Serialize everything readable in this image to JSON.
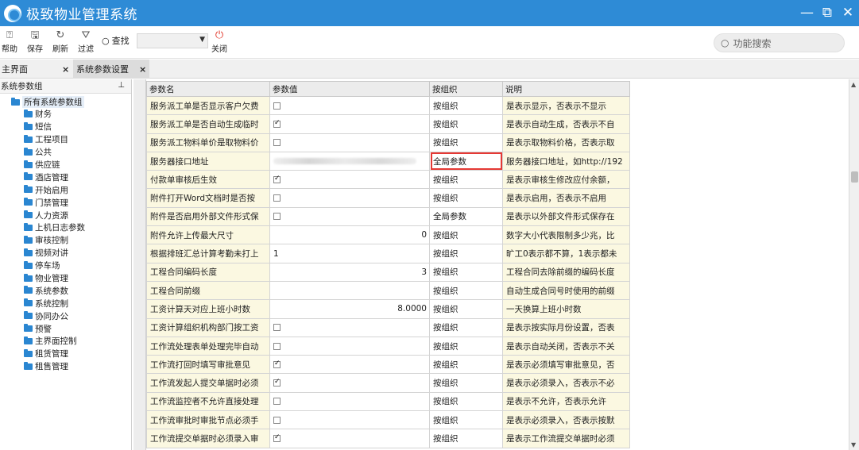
{
  "window": {
    "title": "极致物业管理系统",
    "controls": [
      "—",
      "⧉",
      "✕"
    ]
  },
  "toolbar": {
    "help": "帮助",
    "save": "保存",
    "refresh": "刷新",
    "filter": "过滤",
    "find": "查找",
    "find_select_value": "",
    "close": "关闭",
    "function_search_placeholder": "功能搜索"
  },
  "tabs": [
    {
      "label": "主界面"
    },
    {
      "label": "系统参数设置"
    }
  ],
  "left_panel": {
    "header": "系统参数组",
    "root": "所有系统参数组",
    "groups": [
      "财务",
      "短信",
      "工程项目",
      "公共",
      "供应链",
      "酒店管理",
      "开始启用",
      "门禁管理",
      "人力资源",
      "上机日志参数",
      "审核控制",
      "视频对讲",
      "停车场",
      "物业管理",
      "系统参数",
      "系统控制",
      "协同办公",
      "预警",
      "主界面控制",
      "租赁管理",
      "租售管理"
    ]
  },
  "grid": {
    "columns": [
      "参数名",
      "参数值",
      "按组织",
      "说明"
    ],
    "rows": [
      {
        "name": "服务派工单是否显示客户欠费",
        "type": "check",
        "checked": false,
        "value": "",
        "org": "按组织",
        "desc": "是表示显示，否表示不显示"
      },
      {
        "name": "服务派工单是否自动生成临时",
        "type": "check",
        "checked": true,
        "value": "",
        "org": "按组织",
        "desc": "是表示自动生成，否表示不自"
      },
      {
        "name": "服务派工物料单价是取物料价",
        "type": "check",
        "checked": false,
        "value": "",
        "org": "按组织",
        "desc": "是表示取物料价格，否表示取"
      },
      {
        "name": "服务器接口地址",
        "type": "blurred",
        "checked": false,
        "value": "",
        "org": "全局参数",
        "highlight": true,
        "desc": "服务器接口地址，如http://192"
      },
      {
        "name": "付款单审核后生效",
        "type": "check",
        "checked": true,
        "value": "",
        "org": "按组织",
        "desc": "是表示审核生修改应付余额，"
      },
      {
        "name": "附件打开Word文档时是否按",
        "type": "check",
        "checked": false,
        "value": "",
        "org": "按组织",
        "desc": "是表示启用，否表示不启用"
      },
      {
        "name": "附件是否启用外部文件形式保",
        "type": "check",
        "checked": false,
        "value": "",
        "org": "全局参数",
        "desc": "是表示以外部文件形式保存在"
      },
      {
        "name": "附件允许上传最大尺寸",
        "type": "num",
        "checked": false,
        "value": "0",
        "org": "按组织",
        "desc": "数字大小代表限制多少兆，比"
      },
      {
        "name": "根据排班汇总计算考勤未打上",
        "type": "text",
        "checked": false,
        "value": "1",
        "org": "按组织",
        "desc": "旷工0表示都不算，1表示都未"
      },
      {
        "name": "工程合同编码长度",
        "type": "num",
        "checked": false,
        "value": "3",
        "org": "按组织",
        "desc": "工程合同去除前缀的编码长度"
      },
      {
        "name": "工程合同前缀",
        "type": "text",
        "checked": false,
        "value": "",
        "org": "按组织",
        "desc": "自动生成合同号时使用的前缀"
      },
      {
        "name": "工资计算天对应上班小时数",
        "type": "num",
        "checked": false,
        "value": "8.0000",
        "org": "按组织",
        "desc": "一天换算上班小时数"
      },
      {
        "name": "工资计算组织机构部门按工资",
        "type": "check",
        "checked": false,
        "value": "",
        "org": "按组织",
        "desc": "是表示按实际月份设置，否表"
      },
      {
        "name": "工作流处理表单处理完毕自动",
        "type": "check",
        "checked": false,
        "value": "",
        "org": "按组织",
        "desc": "是表示自动关闭，否表示不关"
      },
      {
        "name": "工作流打回时填写审批意见",
        "type": "check",
        "checked": true,
        "value": "",
        "org": "按组织",
        "desc": "是表示必须填写审批意见，否"
      },
      {
        "name": "工作流发起人提交单据时必须",
        "type": "check",
        "checked": true,
        "value": "",
        "org": "按组织",
        "desc": "是表示必须录入，否表示不必"
      },
      {
        "name": "工作流监控者不允许直接处理",
        "type": "check",
        "checked": false,
        "value": "",
        "org": "按组织",
        "desc": "是表示不允许，否表示允许"
      },
      {
        "name": "工作流审批时审批节点必须手",
        "type": "check",
        "checked": false,
        "value": "",
        "org": "按组织",
        "desc": "是表示必须录入，否表示按默"
      },
      {
        "name": "工作流提交单据时必须录入审",
        "type": "check",
        "checked": true,
        "value": "",
        "org": "按组织",
        "desc": "是表示工作流提交单据时必须"
      }
    ]
  }
}
